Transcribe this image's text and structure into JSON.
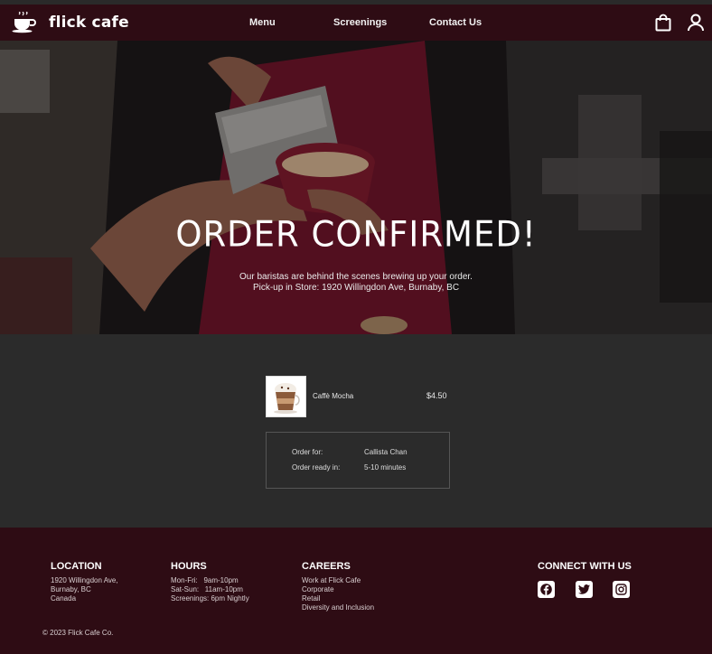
{
  "brand": {
    "name": "flick cafe"
  },
  "nav": {
    "items": [
      "Menu",
      "Screenings",
      "Contact Us"
    ]
  },
  "hero": {
    "title": "ORDER CONFIRMED!",
    "line1": "Our baristas are behind the scenes brewing up your order.",
    "line2": "Pick-up in Store: 1920 Willingdon Ave, Burnaby, BC"
  },
  "order": {
    "item": {
      "name": "Caffè Mocha",
      "price": "$4.50"
    },
    "details": {
      "for_label": "Order for:",
      "for_value": "Callista Chan",
      "ready_label": "Order ready in:",
      "ready_value": "5-10 minutes"
    }
  },
  "footer": {
    "location": {
      "title": "LOCATION",
      "lines": [
        "1920 Willingdon Ave,",
        "Burnaby, BC",
        "Canada"
      ]
    },
    "hours": {
      "title": "HOURS",
      "lines": [
        "Mon-Fri:   9am-10pm",
        "Sat-Sun:   11am-10pm",
        "Screenings: 6pm Nightly"
      ]
    },
    "careers": {
      "title": "CAREERS",
      "links": [
        "Work at Flick Cafe",
        "Corporate",
        "Retail",
        "Diversity and Inclusion"
      ]
    },
    "connect": {
      "title": "CONNECT WITH US",
      "icons": [
        "facebook-icon",
        "twitter-icon",
        "instagram-icon"
      ]
    },
    "copyright": "© 2023 Flick Cafe Co."
  },
  "colors": {
    "nav_bg": "#2e0c14",
    "body_bg": "#2b2b2b",
    "text": "#ffffff"
  }
}
